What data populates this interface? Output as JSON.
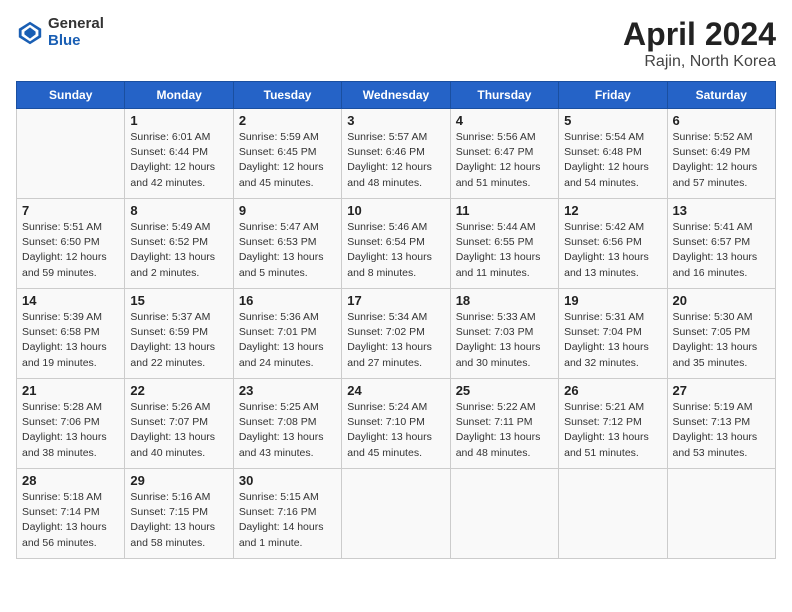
{
  "header": {
    "logo_general": "General",
    "logo_blue": "Blue",
    "month": "April 2024",
    "location": "Rajin, North Korea"
  },
  "days_of_week": [
    "Sunday",
    "Monday",
    "Tuesday",
    "Wednesday",
    "Thursday",
    "Friday",
    "Saturday"
  ],
  "weeks": [
    [
      {
        "day": "",
        "info": ""
      },
      {
        "day": "1",
        "info": "Sunrise: 6:01 AM\nSunset: 6:44 PM\nDaylight: 12 hours\nand 42 minutes."
      },
      {
        "day": "2",
        "info": "Sunrise: 5:59 AM\nSunset: 6:45 PM\nDaylight: 12 hours\nand 45 minutes."
      },
      {
        "day": "3",
        "info": "Sunrise: 5:57 AM\nSunset: 6:46 PM\nDaylight: 12 hours\nand 48 minutes."
      },
      {
        "day": "4",
        "info": "Sunrise: 5:56 AM\nSunset: 6:47 PM\nDaylight: 12 hours\nand 51 minutes."
      },
      {
        "day": "5",
        "info": "Sunrise: 5:54 AM\nSunset: 6:48 PM\nDaylight: 12 hours\nand 54 minutes."
      },
      {
        "day": "6",
        "info": "Sunrise: 5:52 AM\nSunset: 6:49 PM\nDaylight: 12 hours\nand 57 minutes."
      }
    ],
    [
      {
        "day": "7",
        "info": "Sunrise: 5:51 AM\nSunset: 6:50 PM\nDaylight: 12 hours\nand 59 minutes."
      },
      {
        "day": "8",
        "info": "Sunrise: 5:49 AM\nSunset: 6:52 PM\nDaylight: 13 hours\nand 2 minutes."
      },
      {
        "day": "9",
        "info": "Sunrise: 5:47 AM\nSunset: 6:53 PM\nDaylight: 13 hours\nand 5 minutes."
      },
      {
        "day": "10",
        "info": "Sunrise: 5:46 AM\nSunset: 6:54 PM\nDaylight: 13 hours\nand 8 minutes."
      },
      {
        "day": "11",
        "info": "Sunrise: 5:44 AM\nSunset: 6:55 PM\nDaylight: 13 hours\nand 11 minutes."
      },
      {
        "day": "12",
        "info": "Sunrise: 5:42 AM\nSunset: 6:56 PM\nDaylight: 13 hours\nand 13 minutes."
      },
      {
        "day": "13",
        "info": "Sunrise: 5:41 AM\nSunset: 6:57 PM\nDaylight: 13 hours\nand 16 minutes."
      }
    ],
    [
      {
        "day": "14",
        "info": "Sunrise: 5:39 AM\nSunset: 6:58 PM\nDaylight: 13 hours\nand 19 minutes."
      },
      {
        "day": "15",
        "info": "Sunrise: 5:37 AM\nSunset: 6:59 PM\nDaylight: 13 hours\nand 22 minutes."
      },
      {
        "day": "16",
        "info": "Sunrise: 5:36 AM\nSunset: 7:01 PM\nDaylight: 13 hours\nand 24 minutes."
      },
      {
        "day": "17",
        "info": "Sunrise: 5:34 AM\nSunset: 7:02 PM\nDaylight: 13 hours\nand 27 minutes."
      },
      {
        "day": "18",
        "info": "Sunrise: 5:33 AM\nSunset: 7:03 PM\nDaylight: 13 hours\nand 30 minutes."
      },
      {
        "day": "19",
        "info": "Sunrise: 5:31 AM\nSunset: 7:04 PM\nDaylight: 13 hours\nand 32 minutes."
      },
      {
        "day": "20",
        "info": "Sunrise: 5:30 AM\nSunset: 7:05 PM\nDaylight: 13 hours\nand 35 minutes."
      }
    ],
    [
      {
        "day": "21",
        "info": "Sunrise: 5:28 AM\nSunset: 7:06 PM\nDaylight: 13 hours\nand 38 minutes."
      },
      {
        "day": "22",
        "info": "Sunrise: 5:26 AM\nSunset: 7:07 PM\nDaylight: 13 hours\nand 40 minutes."
      },
      {
        "day": "23",
        "info": "Sunrise: 5:25 AM\nSunset: 7:08 PM\nDaylight: 13 hours\nand 43 minutes."
      },
      {
        "day": "24",
        "info": "Sunrise: 5:24 AM\nSunset: 7:10 PM\nDaylight: 13 hours\nand 45 minutes."
      },
      {
        "day": "25",
        "info": "Sunrise: 5:22 AM\nSunset: 7:11 PM\nDaylight: 13 hours\nand 48 minutes."
      },
      {
        "day": "26",
        "info": "Sunrise: 5:21 AM\nSunset: 7:12 PM\nDaylight: 13 hours\nand 51 minutes."
      },
      {
        "day": "27",
        "info": "Sunrise: 5:19 AM\nSunset: 7:13 PM\nDaylight: 13 hours\nand 53 minutes."
      }
    ],
    [
      {
        "day": "28",
        "info": "Sunrise: 5:18 AM\nSunset: 7:14 PM\nDaylight: 13 hours\nand 56 minutes."
      },
      {
        "day": "29",
        "info": "Sunrise: 5:16 AM\nSunset: 7:15 PM\nDaylight: 13 hours\nand 58 minutes."
      },
      {
        "day": "30",
        "info": "Sunrise: 5:15 AM\nSunset: 7:16 PM\nDaylight: 14 hours\nand 1 minute."
      },
      {
        "day": "",
        "info": ""
      },
      {
        "day": "",
        "info": ""
      },
      {
        "day": "",
        "info": ""
      },
      {
        "day": "",
        "info": ""
      }
    ]
  ]
}
